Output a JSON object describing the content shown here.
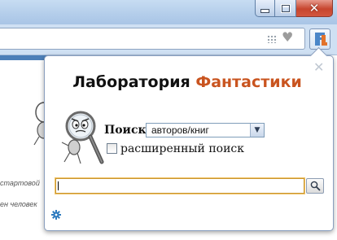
{
  "window": {
    "controls": [
      "minimize",
      "maximize",
      "close"
    ],
    "close_glyph": "✕"
  },
  "toolbar": {
    "icons": [
      "grid-icon",
      "heart-icon"
    ],
    "extension_button": "fantlab-logo-icon"
  },
  "background_page": {
    "text_line_1": "стартовой",
    "text_line_2": "ен человек"
  },
  "popup": {
    "close_glyph": "✕",
    "title_part1": "Лаборатория",
    "title_part2": "Фантастики",
    "search_label": "Поиск:",
    "search_type": {
      "selected": "авторов/книг"
    },
    "advanced_search_label": "расширенный поиск",
    "advanced_search_checked": false,
    "search_input": {
      "value": "",
      "placeholder": ""
    },
    "settings_icon": "gear-icon"
  },
  "colors": {
    "title_accent": "#c9541f",
    "input_border": "#c9962e",
    "gear": "#2e7bbf"
  }
}
